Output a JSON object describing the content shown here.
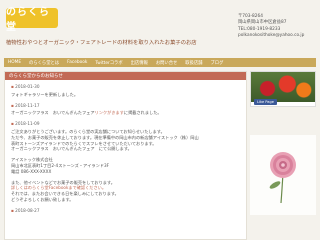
{
  "header": {
    "logo_text": "のらくら堂",
    "tagline": "植物性おやつとオーガニック・フェアトレードの材料を取り入れたお菓子のお店",
    "contact": [
      "〒703-8264",
      "岡山県岡山市中区倉益87",
      "TEL:080-1919-8233",
      "polkanokosithoke@yahoo.co.jp"
    ]
  },
  "nav": [
    "HOME",
    "のらくら堂とは",
    "Facebook",
    "Twitterコラボ",
    "出店情報",
    "お問い合せ",
    "取扱店舗",
    "ブログ"
  ],
  "main": {
    "section_title": "のらくら堂からのお知らせ",
    "posts": [
      {
        "date": "2018-01-30",
        "lines": [
          "フォトギャラリーを更新しました。"
        ]
      },
      {
        "date": "2018-11-17",
        "lines": [
          "オーガニックフラス　おいでんぎんたフェア",
          "リンクがきます"
        ],
        "link_index": 1,
        "suffix": "に掲載されました。"
      },
      {
        "date": "2018-11-09",
        "lines": [
          "ご注文ありがとうございます。のらくら堂の実店舗についてお知らせいたします。",
          "ただ今、お菓子の販売を休止しております。現在準備中の岡山市内の新店舗アイストック（株）岡山",
          "表町ストーンズアイランドでのたらくでスフレをさせていただいております。",
          "オーガニックフラス　おいでんぎんたフェア　にて公開します。"
        ]
      },
      {
        "date": "",
        "lines": [
          "アイストック株式会社",
          "岡山市北区表町1丁目2-4ストーンズ・アイランド3F",
          "電話 086-XXX-XXXX"
        ]
      },
      {
        "date": "",
        "lines": [
          "また、他イベントなどでお菓子の販売をしております。",
          "詳しくはのらくら堂Facebookまで確認ください。",
          "それでは、またお会いできる日を楽しみにしております。",
          "どうぞよろしくお願い致します。"
        ]
      },
      {
        "date": "2018-08-27",
        "lines": []
      }
    ]
  },
  "sidebar": {
    "fb_label": "Like Page"
  }
}
